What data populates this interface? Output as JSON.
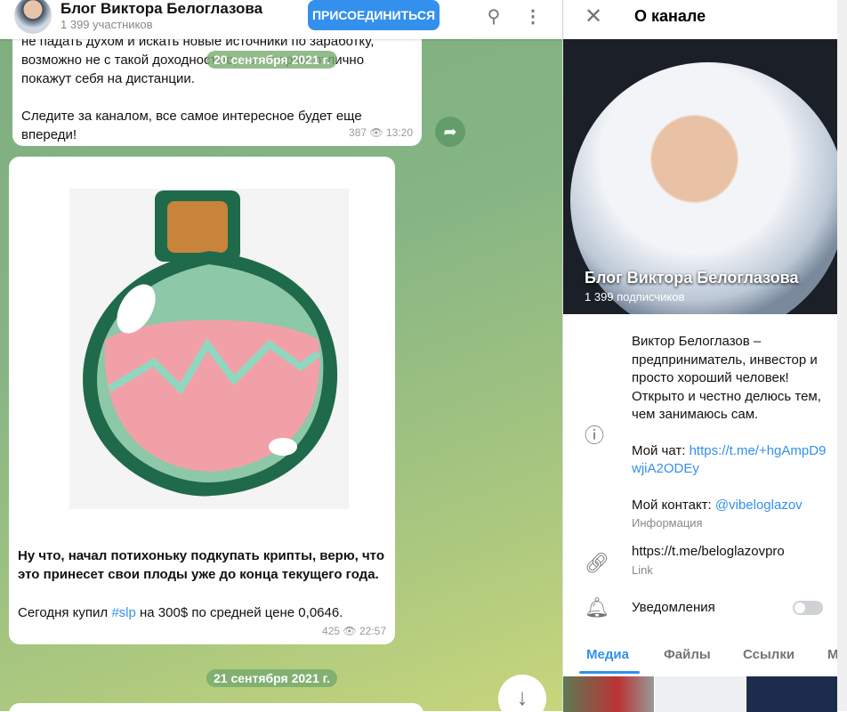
{
  "header": {
    "title": "Блог Виктора Белоглазова",
    "subtitle": "1 399 участников",
    "join_label": "ПРИСОЕДИНИТЬСЯ"
  },
  "messages": [
    {
      "text_lines": [
        "не падать духом и искать новые источники по заработку,",
        "возможно не с такой доходностью, но которые отлично",
        "покажут себя на дистанции."
      ],
      "text2": "Следите за каналом, все самое интересное будет еще впереди!",
      "views": "387",
      "time": "13:20"
    },
    {
      "text1": "Ну что, начал потихоньку подкупать крипты, верю, что это принесет свои плоды уже до конца текущего года.",
      "text2_pre": "Сегодня купил ",
      "hashtag": "#slp",
      "text2_post": " на 300$ по средней цене 0,0646.",
      "views": "425",
      "time": "22:57"
    }
  ],
  "dates": [
    "20 сентября 2021 г.",
    "21 сентября 2021 г."
  ],
  "panel": {
    "title": "О канале",
    "name": "Блог Виктора Белоглазова",
    "subscribers": "1 399 подписчиков",
    "description": "Виктор Белоглазов – предприниматель, инвестор и просто хороший человек! Открыто и честно делюсь тем, чем занимаюсь сам.",
    "chat_label": "Мой чат: ",
    "chat_link": "https://t.me/+hgAmpD9wjiA2ODEy",
    "contact_label": "Мой контакт: ",
    "contact_link": "@vibeloglazov",
    "info_label": "Информация",
    "link": "https://t.me/beloglazovpro",
    "link_label": "Link",
    "notifications": "Уведомления",
    "notifications_on": false,
    "tabs": [
      "Медиа",
      "Файлы",
      "Ссылки",
      "М"
    ]
  },
  "colors": {
    "accent": "#3390ec"
  }
}
